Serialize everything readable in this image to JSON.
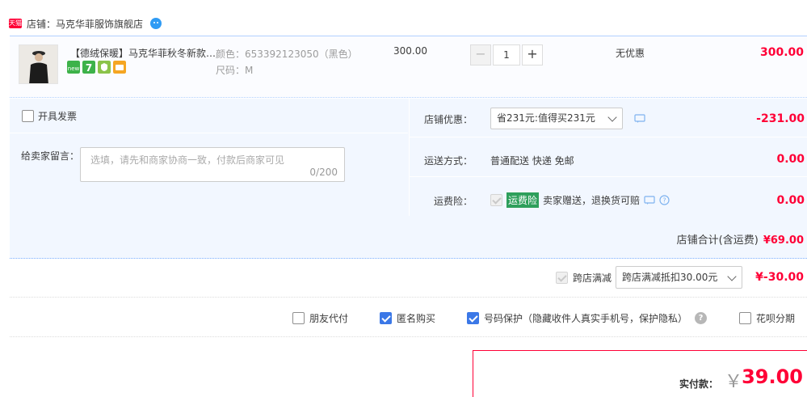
{
  "shop": {
    "badge": "天猫",
    "label": "店铺：马克华菲服饰旗舰店"
  },
  "item": {
    "title": "【德绒保暖】马克华菲秋冬新款…",
    "color": "颜色：653392123050（黑色）",
    "size": "尺码：M",
    "unit_price": "300.00",
    "quantity": "1",
    "discount": "无优惠",
    "subtotal": "300.00",
    "service_icons": [
      "new-icon",
      "seven-days-icon",
      "guarantee-icon",
      "card-icon"
    ]
  },
  "invoice": {
    "label": "开具发票"
  },
  "message": {
    "label": "给卖家留言：",
    "placeholder": "选填，请先和商家协商一致，付款后商家可见",
    "count": "0/200"
  },
  "shop_discount": {
    "label": "店铺优惠：",
    "selected": "省231元:值得买231元",
    "value": "-231.00"
  },
  "shipping": {
    "label": "运送方式：",
    "text": "普通配送 快递 免邮",
    "value": "0.00"
  },
  "freight_insurance": {
    "label": "运费险：",
    "tag": "运费险",
    "text": "卖家赠送，退换货可赔",
    "value": "0.00"
  },
  "shop_total": {
    "label": "店铺合计(含运费)",
    "amount": "¥69.00"
  },
  "cross_shop": {
    "label": "跨店满减",
    "selected": "跨店满减抵扣30.00元",
    "value": "¥-30.00"
  },
  "options": {
    "friend_pay": "朋友代付",
    "anonymous": "匿名购买",
    "number_protect": "号码保护（隐藏收件人真实手机号，保护隐私）",
    "huabei": "花呗分期"
  },
  "payment": {
    "label": "实付款：",
    "currency": "￥",
    "amount": "39.00"
  },
  "colors": {
    "accent_red": "#ff0036",
    "row_blue": "#f2f7ff",
    "border_blue": "#b2d1ff",
    "check_blue": "#3b78e7"
  }
}
